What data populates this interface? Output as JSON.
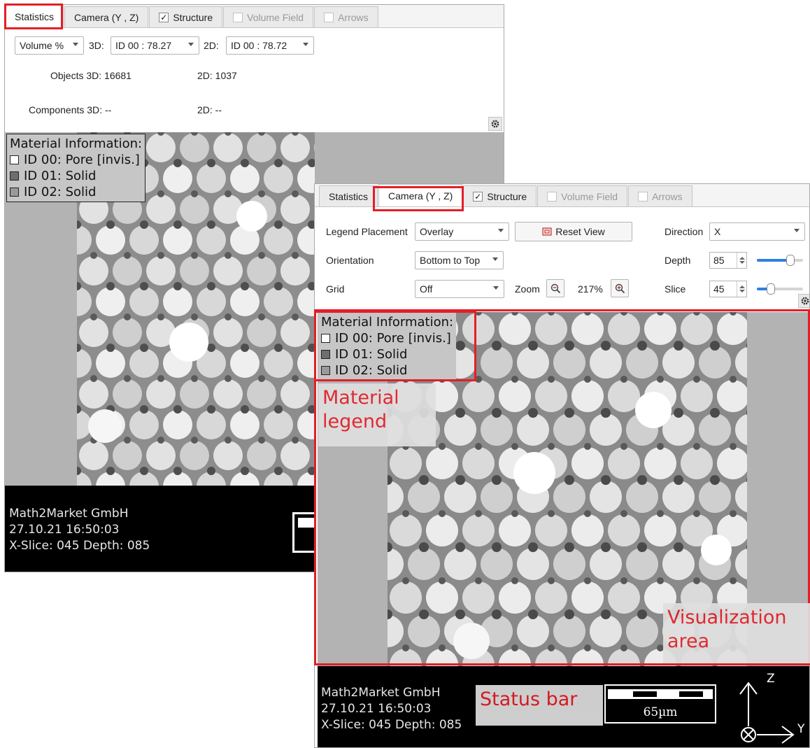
{
  "tabs": [
    {
      "label": "Statistics",
      "checkbox": false,
      "checked": false,
      "disabled": false
    },
    {
      "label": "Camera (Y , Z)",
      "checkbox": false,
      "checked": false,
      "disabled": false
    },
    {
      "label": "Structure",
      "checkbox": true,
      "checked": true,
      "disabled": false
    },
    {
      "label": "Volume Field",
      "checkbox": true,
      "checked": false,
      "disabled": true
    },
    {
      "label": "Arrows",
      "checkbox": true,
      "checked": false,
      "disabled": true
    }
  ],
  "checkmark": "✓",
  "statistics": {
    "measure_select": "Volume %",
    "label_3d": "3D:",
    "select_3d": "ID 00 : 78.27",
    "label_2d": "2D:",
    "select_2d": "ID 00 : 78.72",
    "objects_label": "Objects 3D: 16681",
    "objects_2d": "2D: 1037",
    "components_label": "Components 3D: --",
    "components_2d": "2D: --"
  },
  "camera": {
    "legend_placement_label": "Legend Placement",
    "legend_placement_value": "Overlay",
    "reset_view_label": "Reset View",
    "direction_label": "Direction",
    "direction_value": "X",
    "orientation_label": "Orientation",
    "orientation_value": "Bottom to Top",
    "depth_label": "Depth",
    "depth_value": "85",
    "depth_slider_fraction": 0.72,
    "grid_label": "Grid",
    "grid_value": "Off",
    "zoom_label": "Zoom",
    "zoom_value": "217%",
    "slice_label": "Slice",
    "slice_value": "45",
    "slice_slider_fraction": 0.3
  },
  "legend": {
    "title": "Material Information:",
    "items": [
      {
        "label": "ID 00: Pore [invis.]",
        "color": "#ffffff"
      },
      {
        "label": "ID 01: Solid",
        "color": "#6e6e6e"
      },
      {
        "label": "ID 02: Solid",
        "color": "#9a9a9a"
      }
    ]
  },
  "status": {
    "company": "Math2Market GmbH",
    "datetime": "27.10.21 16:50:03",
    "slice_info": "X-Slice: 045 Depth: 085",
    "scale_label": "65µm",
    "axis_up": "Z",
    "axis_right": "Y"
  },
  "annotations": {
    "material_legend": "Material legend",
    "visualization_area": "Visualization area",
    "status_bar": "Status bar"
  },
  "colors": {
    "highlight": "#e41e26",
    "slider_fill": "#2f7fe0"
  },
  "icons": {
    "settings": "gear-icon",
    "reset_view": "reset-view-icon",
    "zoom_out": "zoom-out-icon",
    "zoom_in": "zoom-in-icon"
  }
}
